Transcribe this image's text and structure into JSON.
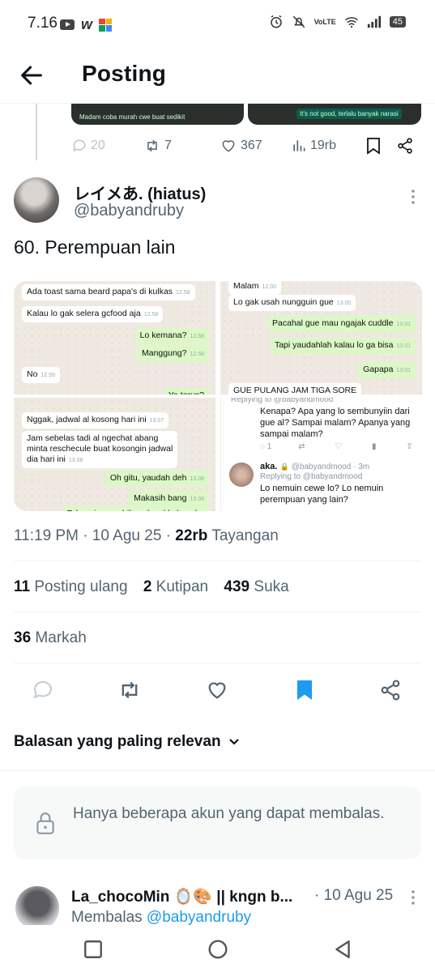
{
  "status_bar": {
    "time": "7.16",
    "battery": "45",
    "network": "VoLTE"
  },
  "header": {
    "back_icon": "arrow-left-icon",
    "title": "Posting"
  },
  "previous_post": {
    "preview_texts": [
      "Madam coba murah cwe buat sedikit",
      "It's not good, terlalu banyak narasi"
    ],
    "reply_count": "20",
    "repost_count": "7",
    "like_count": "367",
    "view_count": "19rb"
  },
  "post": {
    "display_name": "レイメあ. (hiatus)",
    "handle": "@babyandruby",
    "text": "60. Perempuan lain",
    "images": {
      "top_left": [
        {
          "text": "Ada toast sama beard papa's di kulkas",
          "time": "12.58",
          "dir": "in"
        },
        {
          "text": "Kalau lo gak selera gcfood aja",
          "time": "12.58",
          "dir": "in"
        },
        {
          "text": "Lo kemana?",
          "time": "12.58",
          "dir": "out"
        },
        {
          "text": "Manggung?",
          "time": "12.58",
          "dir": "out"
        },
        {
          "text": "No",
          "time": "12.59",
          "dir": "in"
        },
        {
          "text": "Ya terus?",
          "time": "",
          "dir": "out"
        }
      ],
      "top_right": [
        {
          "text": "Malam",
          "time": "12.00",
          "dir": "in"
        },
        {
          "text": "Lo gak usah nungguin gue",
          "time": "13.00",
          "dir": "in"
        },
        {
          "text": "Pacahal gue mau ngajak cuddle",
          "time": "13.01",
          "dir": "out"
        },
        {
          "text": "Tapi yaudahlah kalau lo ga bisa",
          "time": "13.01",
          "dir": "out"
        },
        {
          "text": "Gapapa",
          "time": "13.01",
          "dir": "out"
        },
        {
          "text": "GUE PULANG JAM TIGA SORE",
          "time": "",
          "dir": "in"
        }
      ],
      "bottom_left": [
        {
          "text": "Nggak, jadwal al kosong hari ini",
          "time": "13.07",
          "dir": "in"
        },
        {
          "text": "Jam sebelas tadi al ngechat abang\nminta reschecule buat kosongin jadwal\ndia hari ini",
          "time": "13.08",
          "dir": "in"
        },
        {
          "text": "Oh gitu, yaudah deh",
          "time": "13.08",
          "dir": "out"
        },
        {
          "text": "Makasih bang",
          "time": "13.09",
          "dir": "out"
        },
        {
          "text": "Tolong jangan bilang ke al kalau aka",
          "time": "",
          "dir": "out"
        }
      ],
      "bottom_right": {
        "top_replying": "Replying to @babyandmood",
        "top_text": "Kenapa? Apa yang lo sembunyiin dari gue al? Sampai malam? Apanya yang sampai malam?",
        "reply_count": "1",
        "name": "aka.",
        "handle": "@babyandmood · 3m",
        "replying": "Replying to @babyandmood",
        "text": "Lo nemuin cewe lo? Lo nemuin perempuan yang lain?"
      }
    },
    "timestamp": "11:19 PM · 10 Agu 25 · ",
    "views_value": "22rb",
    "views_label": " Tayangan",
    "reposts_value": "11",
    "reposts_label": "Posting ulang",
    "quotes_value": "2",
    "quotes_label": "Kutipan",
    "likes_value": "439",
    "likes_label": "Suka",
    "bookmarks_value": "36",
    "bookmarks_label": "Markah"
  },
  "action_icons": [
    "reply-icon",
    "repost-icon",
    "like-icon",
    "bookmark-filled-icon",
    "share-icon"
  ],
  "accent_color": "#1d9bf0",
  "replies": {
    "sort_label": "Balasan yang paling relevan",
    "restriction_text": "Hanya beberapa akun yang dapat membalas.",
    "first_reply": {
      "name": "La_chocoMin 🪞🎨 || kngn b...",
      "date": "· 10 Agu 25",
      "replying_prefix": "Membalas ",
      "replying_handle": "@babyandruby"
    }
  }
}
